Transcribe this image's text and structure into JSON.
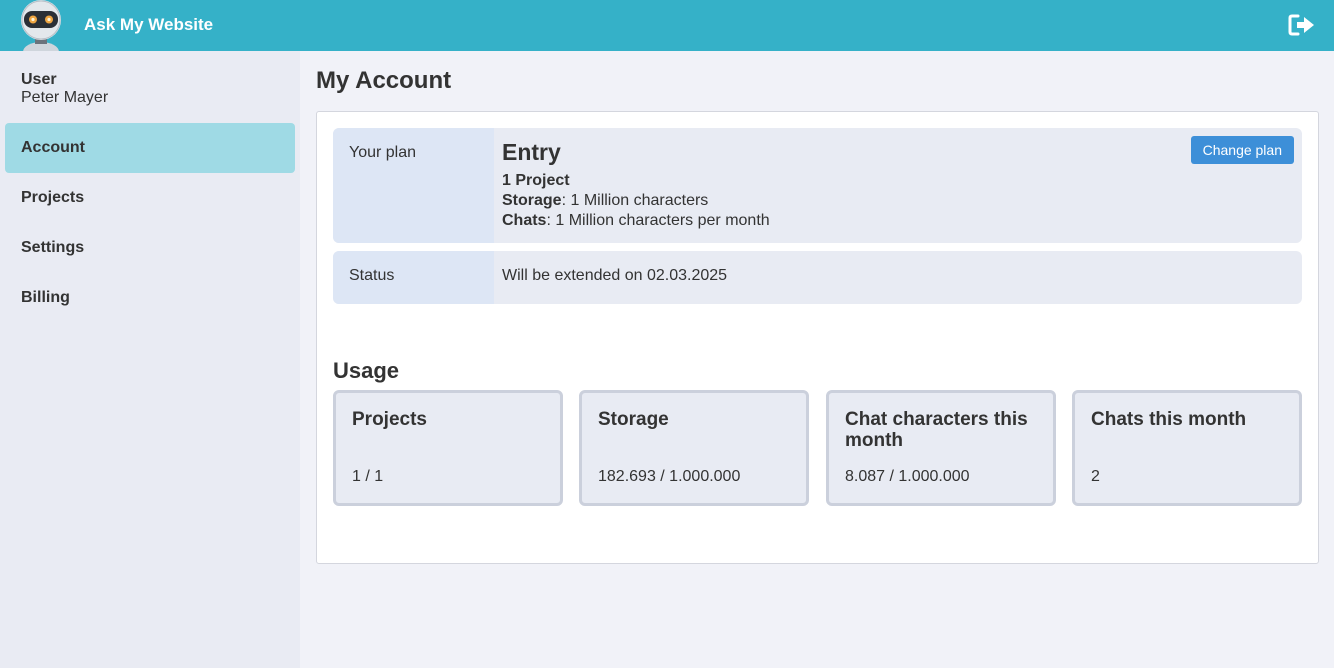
{
  "header": {
    "app_title": "Ask My Website"
  },
  "sidebar": {
    "user_label": "User",
    "user_name": "Peter Mayer",
    "items": [
      {
        "label": "Account",
        "active": true
      },
      {
        "label": "Projects"
      },
      {
        "label": "Settings"
      },
      {
        "label": "Billing"
      }
    ]
  },
  "main": {
    "title": "My Account",
    "plan": {
      "label": "Your plan",
      "name": "Entry",
      "projects": "1 Project",
      "storage_key": "Storage",
      "storage_value": ": 1 Million characters",
      "chats_key": "Chats",
      "chats_value": ": 1 Million characters per month",
      "change_button": "Change plan"
    },
    "status": {
      "label": "Status",
      "value": "Will be extended on 02.03.2025"
    },
    "usage": {
      "title": "Usage",
      "cards": [
        {
          "name": "Projects",
          "value": "1 / 1"
        },
        {
          "name": "Storage",
          "value": "182.693 / 1.000.000"
        },
        {
          "name": "Chat characters this month",
          "value": "8.087 / 1.000.000"
        },
        {
          "name": "Chats this month",
          "value": "2"
        }
      ]
    }
  },
  "colors": {
    "header": "#35b1c8",
    "active_nav": "#9fdae5",
    "button": "#3d8fd8"
  }
}
